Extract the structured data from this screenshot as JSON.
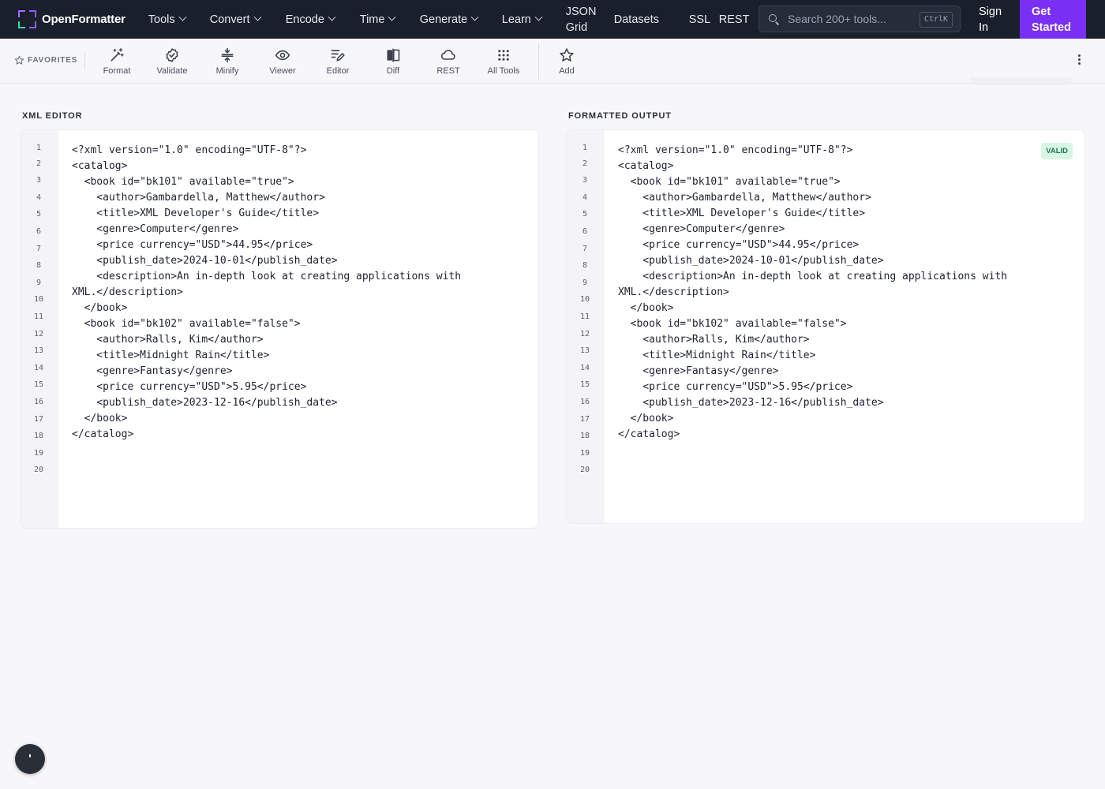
{
  "brand": {
    "name": "OpenFormatter"
  },
  "nav": {
    "menus": [
      {
        "label": "Tools"
      },
      {
        "label": "Convert"
      },
      {
        "label": "Encode"
      },
      {
        "label": "Time"
      },
      {
        "label": "Generate"
      },
      {
        "label": "Learn"
      }
    ],
    "json_grid_line1": "JSON",
    "json_grid_line2": "Grid",
    "datasets": "Datasets",
    "ssl": "SSL",
    "rest": "REST",
    "search_placeholder": "Search 200+ tools...",
    "search_shortcut": "CtrlK",
    "sign_in_line1": "Sign",
    "sign_in_line2": "In",
    "get_started_line1": "Get",
    "get_started_line2": "Started"
  },
  "toolbar": {
    "favorites_label": "FAVORITES",
    "tools": [
      {
        "label": "Format",
        "icon": "magic-wand-icon"
      },
      {
        "label": "Validate",
        "icon": "check-badge-icon"
      },
      {
        "label": "Minify",
        "icon": "compress-icon"
      },
      {
        "label": "Viewer",
        "icon": "eye-icon"
      },
      {
        "label": "Editor",
        "icon": "edit-lines-icon"
      },
      {
        "label": "Diff",
        "icon": "diff-icon"
      },
      {
        "label": "REST",
        "icon": "cloud-icon"
      },
      {
        "label": "All Tools",
        "icon": "grid-icon"
      }
    ],
    "add_label": "Add"
  },
  "editor": {
    "title": "XML EDITOR",
    "line_count": 20,
    "lines": [
      "<?xml version=\"1.0\" encoding=\"UTF-8\"?>",
      "<catalog>",
      "  <book id=\"bk101\" available=\"true\">",
      "    <author>Gambardella, Matthew</author>",
      "    <title>XML Developer's Guide</title>",
      "    <genre>Computer</genre>",
      "    <price currency=\"USD\">44.95</price>",
      "    <publish_date>2024-10-01</publish_date>",
      "    <description>An in-depth look at creating applications with",
      "XML.</description>",
      "  </book>",
      "  <book id=\"bk102\" available=\"false\">",
      "    <author>Ralls, Kim</author>",
      "    <title>Midnight Rain</title>",
      "    <genre>Fantasy</genre>",
      "    <price currency=\"USD\">5.95</price>",
      "    <publish_date>2023-12-16</publish_date>",
      "  </book>",
      "</catalog>"
    ]
  },
  "output": {
    "title": "FORMATTED OUTPUT",
    "status_badge": "VALID",
    "line_count": 20,
    "lines": [
      "<?xml version=\"1.0\" encoding=\"UTF-8\"?>",
      "<catalog>",
      "  <book id=\"bk101\" available=\"true\">",
      "    <author>Gambardella, Matthew</author>",
      "    <title>XML Developer's Guide</title>",
      "    <genre>Computer</genre>",
      "    <price currency=\"USD\">44.95</price>",
      "    <publish_date>2024-10-01</publish_date>",
      "    <description>An in-depth look at creating applications with",
      "XML.</description>",
      "  </book>",
      "  <book id=\"bk102\" available=\"false\">",
      "    <author>Ralls, Kim</author>",
      "    <title>Midnight Rain</title>",
      "    <genre>Fantasy</genre>",
      "    <price currency=\"USD\">5.95</price>",
      "    <publish_date>2023-12-16</publish_date>",
      "  </book>",
      "</catalog>"
    ]
  },
  "colors": {
    "nav_bg": "#1a1f2c",
    "accent": "#7a2ff5",
    "valid_bg": "#d9f5e6",
    "valid_text": "#16794a"
  }
}
